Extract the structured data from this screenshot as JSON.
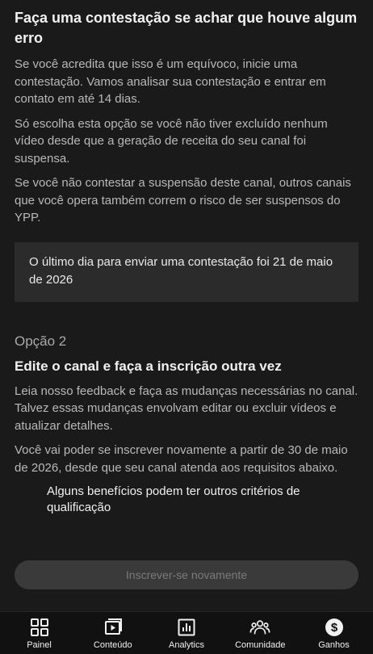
{
  "section1": {
    "title": "Faça uma contestação se achar que houve algum erro",
    "paragraphs": [
      "Se você acredita que isso é um equívoco, inicie uma contestação. Vamos analisar sua contestação e entrar em contato em até 14 dias.",
      "Só escolha esta opção se você não tiver excluído nenhum vídeo desde que a geração de receita do seu canal foi suspensa.",
      "Se você não contestar a suspensão deste canal, outros canais que você opera também correm o risco de ser suspensos do YPP."
    ],
    "notice": "O último dia para enviar uma contestação foi 21 de maio de 2026"
  },
  "section2": {
    "option_label": "Opção 2",
    "title": "Edite o canal e faça a inscrição outra vez",
    "paragraphs": [
      "Leia nosso feedback e faça as mudanças necessárias no canal. Talvez essas mudanças envolvam editar ou excluir vídeos e atualizar detalhes.",
      "Você vai poder se inscrever novamente a partir de 30 de maio de 2026, desde que seu canal atenda aos requisitos abaixo."
    ],
    "note": "Alguns benefícios podem ter outros critérios de qualificação"
  },
  "cta": {
    "label": "Inscrever-se novamente",
    "disabled": true
  },
  "bottom_nav": {
    "items": [
      {
        "label": "Painel",
        "icon": "dashboard-icon"
      },
      {
        "label": "Conteúdo",
        "icon": "content-icon"
      },
      {
        "label": "Analytics",
        "icon": "analytics-icon"
      },
      {
        "label": "Comunidade",
        "icon": "community-icon"
      },
      {
        "label": "Ganhos",
        "icon": "earn-icon"
      }
    ]
  }
}
